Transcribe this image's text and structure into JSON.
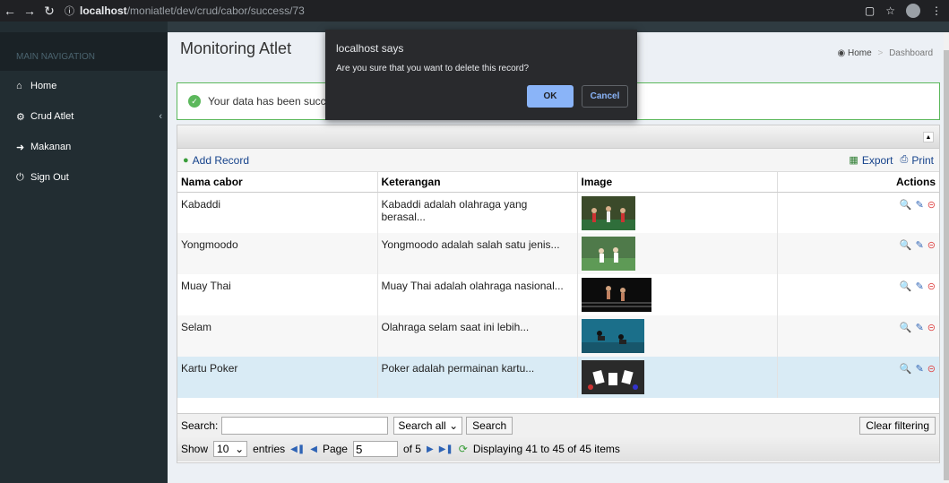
{
  "browser": {
    "url_host": "localhost",
    "url_path": "/moniatlet/dev/crud/cabor/success/73",
    "colors": {
      "bar": "#202124"
    }
  },
  "sidebar": {
    "header": "MAIN NAVIGATION",
    "items": [
      {
        "label": "Home",
        "icon": "home-icon"
      },
      {
        "label": "Crud Atlet",
        "icon": "gear-icon"
      },
      {
        "label": "Makanan",
        "icon": "sign-in-icon"
      },
      {
        "label": "Sign Out",
        "icon": "power-icon"
      }
    ]
  },
  "header": {
    "title": "Monitoring Atlet",
    "breadcrumb": {
      "home": "Home",
      "current": "Dashboard"
    }
  },
  "alert": {
    "text": "Your data has been successf"
  },
  "toolbar": {
    "add": "Add Record",
    "export": "Export",
    "print": "Print"
  },
  "table": {
    "columns": [
      "Nama cabor",
      "Keterangan",
      "Image",
      "Actions"
    ],
    "rows": [
      {
        "name": "Kabaddi",
        "desc": "Kabaddi adalah olahraga yang berasal..."
      },
      {
        "name": "Yongmoodo",
        "desc": "Yongmoodo adalah salah satu jenis..."
      },
      {
        "name": "Muay Thai",
        "desc": "Muay Thai adalah olahraga nasional..."
      },
      {
        "name": "Selam",
        "desc": "Olahraga selam saat ini lebih..."
      },
      {
        "name": "Kartu Poker",
        "desc": "Poker adalah permainan kartu..."
      }
    ]
  },
  "search": {
    "label": "Search:",
    "value": "",
    "scope": "Search all",
    "button": "Search",
    "clear": "Clear filtering"
  },
  "pager": {
    "show": "Show",
    "per_page": "10",
    "entries": "entries",
    "page_label": "Page",
    "page": "5",
    "of": "of 5",
    "status": "Displaying 41 to 45 of 45 items"
  },
  "dialog": {
    "title": "localhost says",
    "message": "Are you sure that you want to delete this record?",
    "ok": "OK",
    "cancel": "Cancel"
  }
}
